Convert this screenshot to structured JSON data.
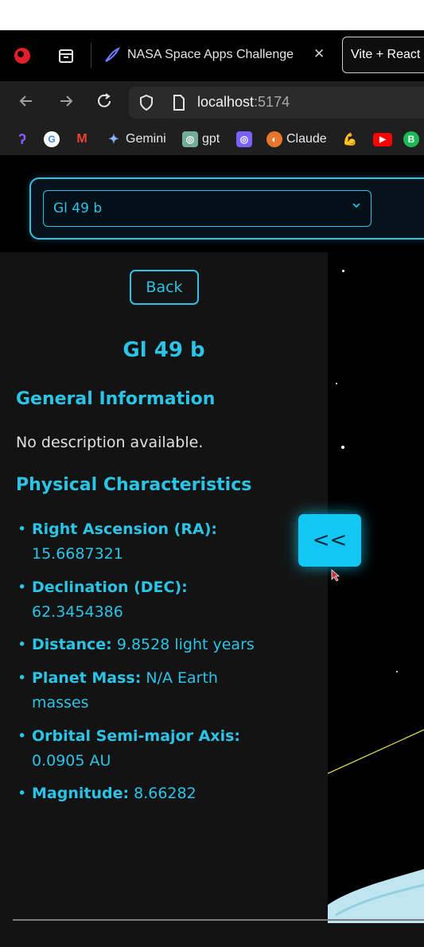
{
  "browser": {
    "active_tab_title": "NASA Space Apps Challenge",
    "active_tab_close": "✕",
    "second_tab_title": "Vite + React",
    "url_host": "localhost",
    "url_port": ":5174",
    "bookmarks": [
      {
        "label": "",
        "icon": "p-icon"
      },
      {
        "label": "",
        "icon": "google-icon"
      },
      {
        "label": "",
        "icon": "gmail-icon"
      },
      {
        "label": "Gemini",
        "icon": "gemini-icon"
      },
      {
        "label": "gpt",
        "icon": "chatgpt-icon"
      },
      {
        "label": "",
        "icon": "chatgpt-purple-icon"
      },
      {
        "label": "Claude",
        "icon": "claude-icon"
      },
      {
        "label": "",
        "icon": "muscle-icon"
      },
      {
        "label": "",
        "icon": "youtube-icon"
      },
      {
        "label": "B",
        "icon": "b-icon"
      }
    ]
  },
  "selector": {
    "selected": "Gl 49 b"
  },
  "sidebar": {
    "back_label": "Back",
    "planet_name": "Gl 49 b",
    "general_heading": "General Information",
    "description": "No description available.",
    "physical_heading": "Physical Characteristics",
    "properties": [
      {
        "label": "Right Ascension (RA):",
        "value": "15.6687321"
      },
      {
        "label": "Declination (DEC):",
        "value": "62.3454386"
      },
      {
        "label": "Distance:",
        "value": "9.8528 light years"
      },
      {
        "label": "Planet Mass:",
        "value": "N/A Earth masses"
      },
      {
        "label": "Orbital Semi-major Axis:",
        "value": "0.0905 AU"
      },
      {
        "label": "Magnitude:",
        "value": "8.66282"
      }
    ]
  },
  "collapse_label": "<<",
  "colors": {
    "accent": "#2bc4e6",
    "panel_bg": "#131313",
    "button_glow": "#12c8f2"
  }
}
